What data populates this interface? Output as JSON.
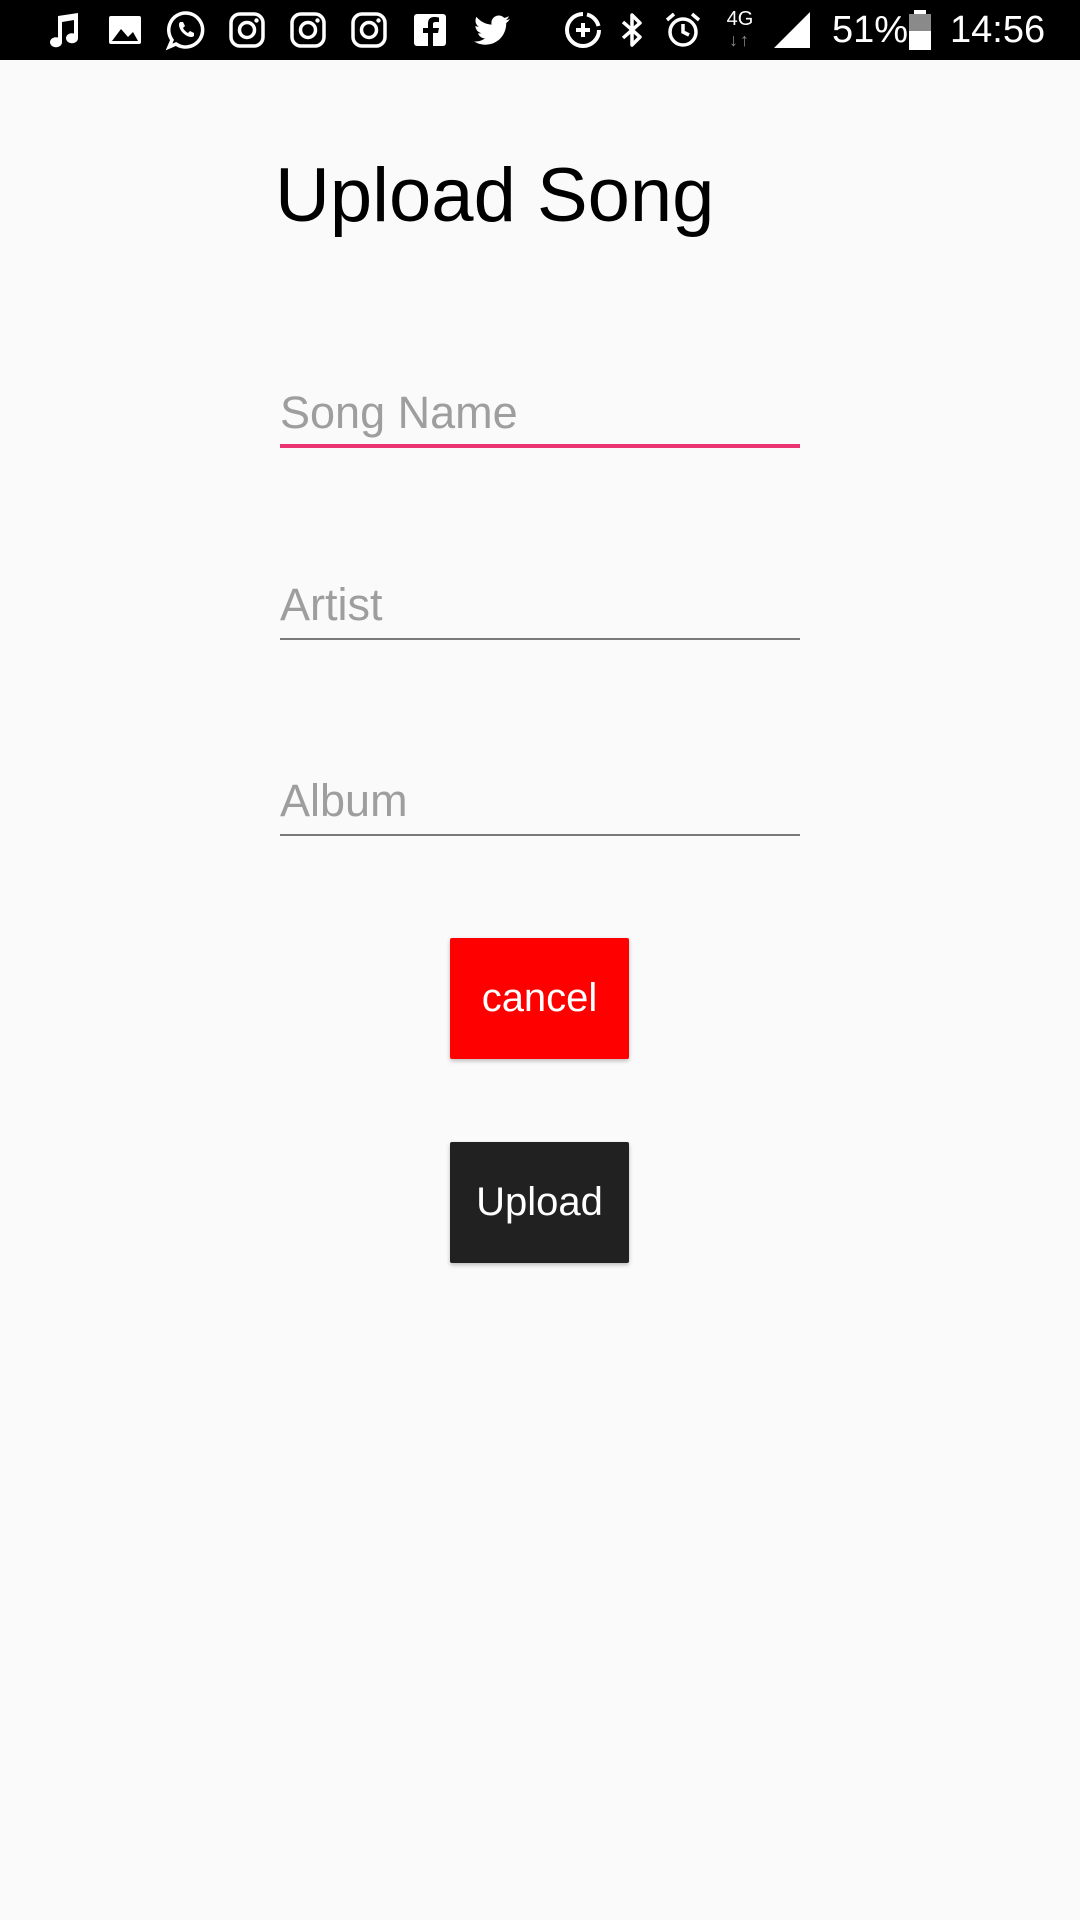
{
  "status_bar": {
    "notification_icons": [
      "music-note-icon",
      "image-icon",
      "whatsapp-icon",
      "instagram-icon",
      "instagram-icon",
      "instagram-icon",
      "facebook-icon",
      "twitter-icon"
    ],
    "network_type": "4G",
    "battery_percent": "51%",
    "time": "14:56"
  },
  "page": {
    "title": "Upload Song"
  },
  "form": {
    "song_name": {
      "value": "",
      "placeholder": "Song Name"
    },
    "artist": {
      "value": "",
      "placeholder": "Artist"
    },
    "album": {
      "value": "",
      "placeholder": "Album"
    }
  },
  "buttons": {
    "cancel_label": "cancel",
    "upload_label": "Upload"
  },
  "colors": {
    "focus_accent": "#e91e63",
    "cancel_bg": "#ff0000",
    "upload_bg": "#212121",
    "background": "#fafafa"
  }
}
